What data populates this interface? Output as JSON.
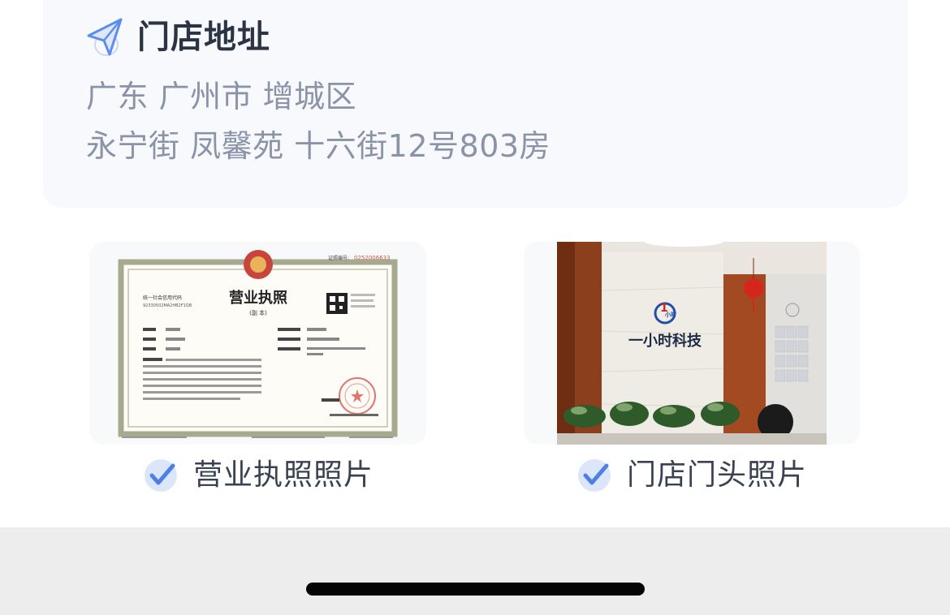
{
  "address": {
    "title": "门店地址",
    "line1": "广东 广州市 增城区",
    "line2": "永宁街 凤馨苑 十六街12号803房"
  },
  "photos": {
    "license": {
      "caption": "营业执照照片",
      "doc_title": "营业执照",
      "doc_subtitle": "(副  本)"
    },
    "storefront": {
      "caption": "门店门头照片",
      "logo_text": "一小时科技",
      "logo_mark": "1小时"
    }
  },
  "colors": {
    "accent": "#5b8def",
    "title": "#2b3444",
    "address_text": "#8a93a8",
    "caption_text": "#3a4252",
    "card_bg": "#f8f9fc",
    "bottom_bar": "#ededed"
  },
  "icons": {
    "address": "navigation-arrow-icon",
    "check": "check-circle-icon"
  }
}
